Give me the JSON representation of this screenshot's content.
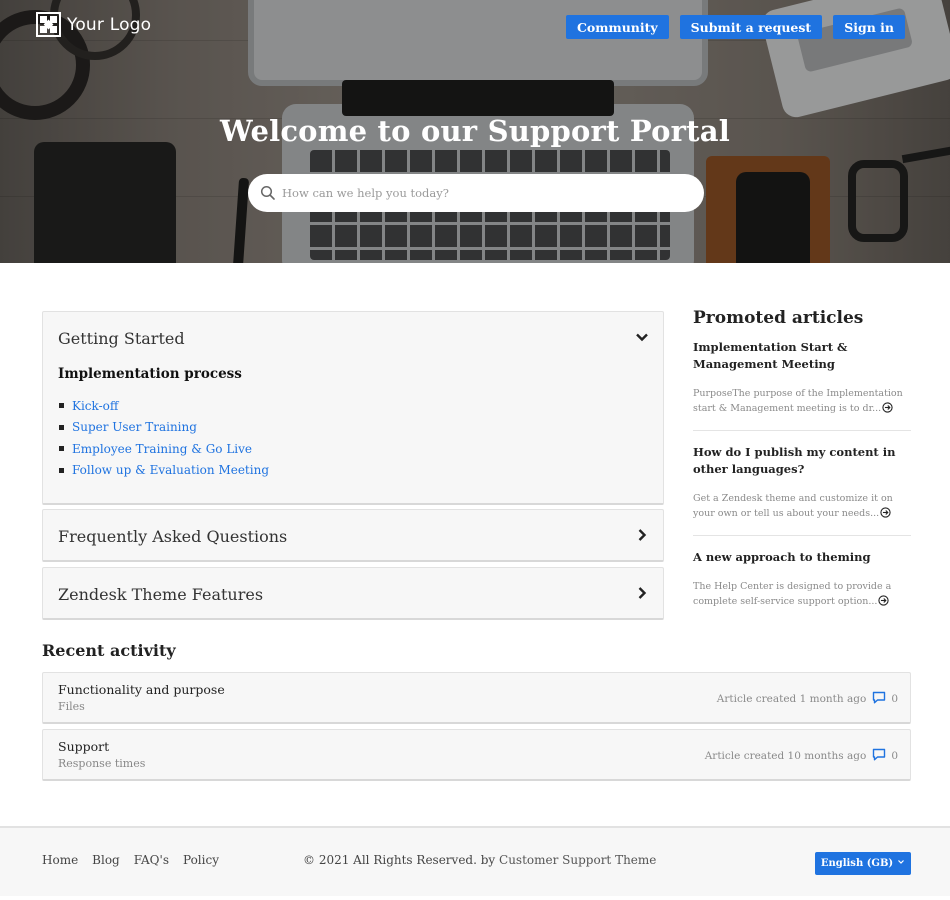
{
  "header": {
    "logo_text": "Your Logo",
    "nav": [
      {
        "label": "Community"
      },
      {
        "label": "Submit a request"
      },
      {
        "label": "Sign in"
      }
    ]
  },
  "hero": {
    "title": "Welcome to our Support Portal",
    "search_placeholder": "How can we help you today?"
  },
  "categories": [
    {
      "title": "Getting Started",
      "expanded": true,
      "section_title": "Implementation process",
      "links": [
        "Kick-off",
        "Super User Training",
        "Employee Training & Go Live",
        "Follow up & Evaluation Meeting"
      ]
    },
    {
      "title": "Frequently Asked Questions",
      "expanded": false
    },
    {
      "title": "Zendesk Theme Features",
      "expanded": false
    }
  ],
  "promoted": {
    "heading": "Promoted articles",
    "items": [
      {
        "title": "Implementation Start & Management Meeting",
        "excerpt": "PurposeThe purpose of the Implementation start & Management meeting is to dr..."
      },
      {
        "title": "How do I publish my content in other languages?",
        "excerpt": "Get a Zendesk theme and customize it on your own or tell us about your needs..."
      },
      {
        "title": "A new approach to theming",
        "excerpt": "The Help Center is designed to provide a complete self-service support option..."
      }
    ]
  },
  "recent": {
    "heading": "Recent activity",
    "items": [
      {
        "title": "Functionality and purpose",
        "section": "Files",
        "meta": "Article created 1 month ago",
        "comments": "0"
      },
      {
        "title": "Support",
        "section": "Response times",
        "meta": "Article created 10 months ago",
        "comments": "0"
      }
    ]
  },
  "footer": {
    "links": [
      "Home",
      "Blog",
      "FAQ's",
      "Policy"
    ],
    "copyright_prefix": "© 2021 All Rights Reserved. by",
    "theme_link": "Customer Support Theme",
    "language": "English (GB)"
  },
  "colors": {
    "accent": "#1f73e0",
    "link": "#1f73e0",
    "panel_bg": "#f7f7f7",
    "muted_text": "#8a8a8a"
  },
  "icons": [
    "logo-mark-icon",
    "search-icon",
    "chevron-down-icon",
    "chevron-right-icon",
    "circle-arrow-right-icon",
    "comment-icon"
  ]
}
